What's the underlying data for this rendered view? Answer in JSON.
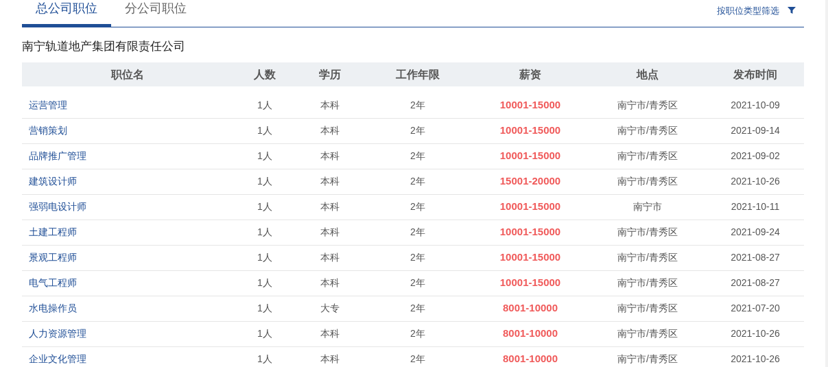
{
  "tabs": [
    {
      "label": "总公司职位",
      "selected": true
    },
    {
      "label": "分公司职位",
      "selected": false
    }
  ],
  "filter": {
    "label": "按职位类型筛选"
  },
  "company": "南宁轨道地产集团有限责任公司",
  "table": {
    "columns": [
      "职位名",
      "人数",
      "学历",
      "工作年限",
      "薪资",
      "地点",
      "发布时间"
    ],
    "rows": [
      [
        "运营管理",
        "1人",
        "本科",
        "2年",
        "10001-15000",
        "南宁市/青秀区",
        "2021-10-09"
      ],
      [
        "营销策划",
        "1人",
        "本科",
        "2年",
        "10001-15000",
        "南宁市/青秀区",
        "2021-09-14"
      ],
      [
        "品牌推广管理",
        "1人",
        "本科",
        "2年",
        "10001-15000",
        "南宁市/青秀区",
        "2021-09-02"
      ],
      [
        "建筑设计师",
        "1人",
        "本科",
        "2年",
        "15001-20000",
        "南宁市/青秀区",
        "2021-10-26"
      ],
      [
        "强弱电设计师",
        "1人",
        "本科",
        "2年",
        "10001-15000",
        "南宁市",
        "2021-10-11"
      ],
      [
        "土建工程师",
        "1人",
        "本科",
        "2年",
        "10001-15000",
        "南宁市/青秀区",
        "2021-09-24"
      ],
      [
        "景观工程师",
        "1人",
        "本科",
        "2年",
        "10001-15000",
        "南宁市/青秀区",
        "2021-08-27"
      ],
      [
        "电气工程师",
        "1人",
        "本科",
        "2年",
        "10001-15000",
        "南宁市/青秀区",
        "2021-08-27"
      ],
      [
        "水电操作员",
        "1人",
        "大专",
        "2年",
        "8001-10000",
        "南宁市/青秀区",
        "2021-07-20"
      ],
      [
        "人力资源管理",
        "1人",
        "本科",
        "2年",
        "8001-10000",
        "南宁市/青秀区",
        "2021-10-26"
      ],
      [
        "企业文化管理",
        "1人",
        "本科",
        "2年",
        "8001-10000",
        "南宁市/青秀区",
        "2021-10-26"
      ]
    ]
  }
}
